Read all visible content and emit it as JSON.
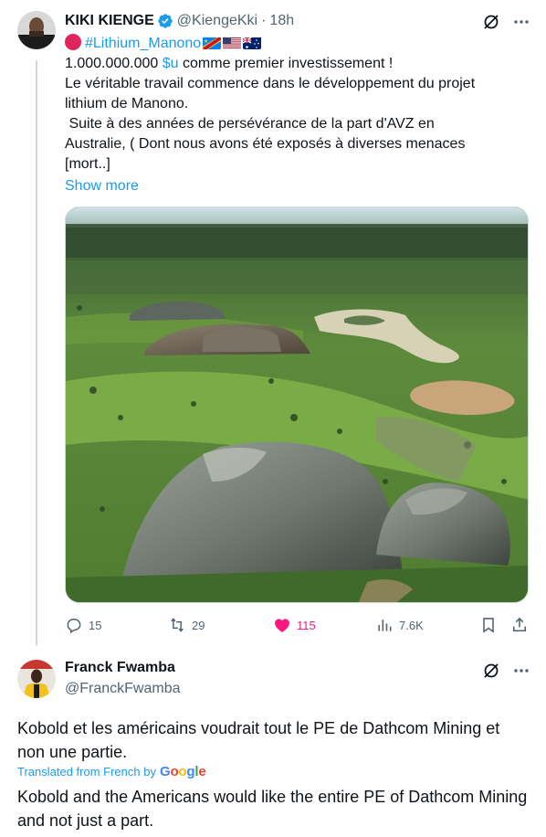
{
  "tweet": {
    "author_name": "KIKI KIENGE",
    "author_handle": "@KiengeKki",
    "separator": "·",
    "time": "18h",
    "hashtag": "#Lithium_Manono",
    "line1_amount": "1.000.000.000 ",
    "line1_cashtag": "$u",
    "line1_rest": " comme premier investissement !",
    "line2": "Le véritable travail commence dans le développement du projet",
    "line3": "lithium de Manono.",
    "line4": " Suite à des années de persévérance de la part d'AVZ en",
    "line5": "Australie, ( Dont nous avons été exposés à diverses menaces",
    "line6": "[mort..]",
    "show_more": "Show more",
    "media_icon": "open-pit-mine-aerial-photo",
    "flags": [
      "dr-congo-flag",
      "usa-flag",
      "australia-flag"
    ]
  },
  "actions": {
    "replies": "15",
    "reposts": "29",
    "likes": "115",
    "views": "7.6K"
  },
  "reply": {
    "author_name": "Franck Fwamba",
    "author_handle": "@FranckFwamba",
    "text": "Kobold et les américains voudrait tout le PE de Dathcom Mining et non une partie.",
    "translated_label": "Translated from French by",
    "translator": "Google",
    "translation": "Kobold and the Americans would like the entire PE of Dathcom Mining and not just a part."
  },
  "colors": {
    "accent": "#1d9bf0",
    "like": "#f91880",
    "secondary_text": "#536471"
  }
}
